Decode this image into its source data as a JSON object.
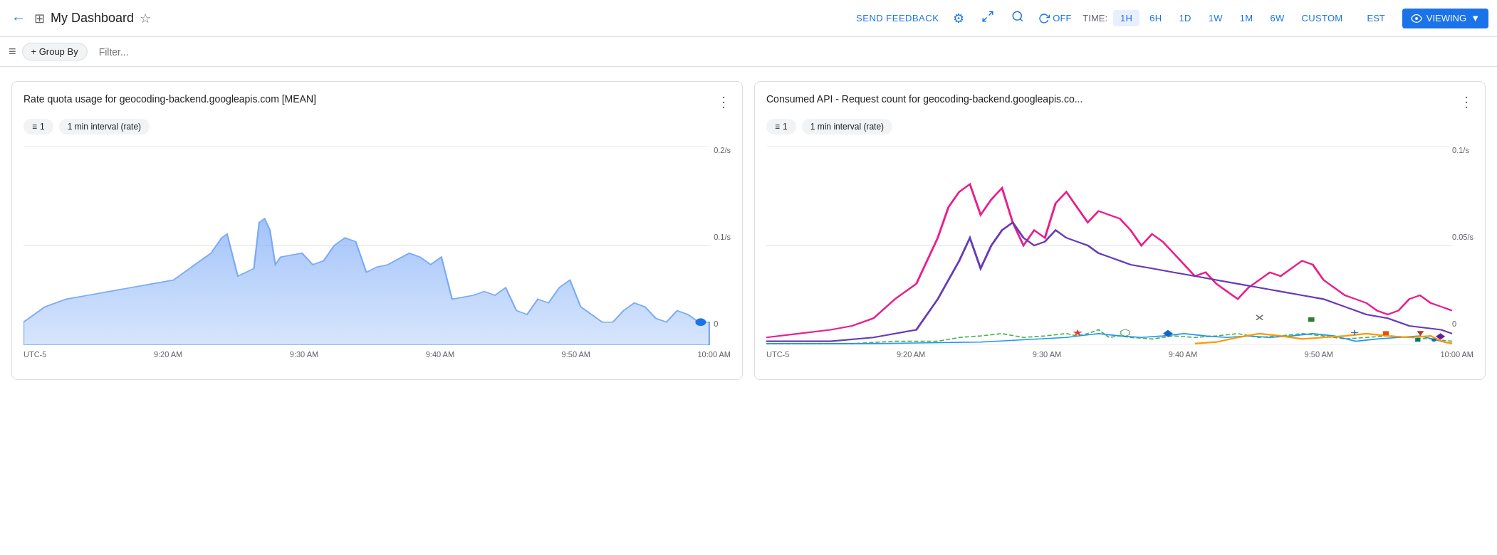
{
  "header": {
    "back_label": "←",
    "dashboard_icon": "⊞",
    "title": "My Dashboard",
    "star_icon": "☆",
    "send_feedback": "SEND FEEDBACK",
    "settings_icon": "⚙",
    "fullscreen_icon": "⛶",
    "search_icon": "🔍",
    "refresh_label": "OFF",
    "refresh_icon": "↻",
    "time_label": "TIME:",
    "time_options": [
      {
        "label": "1H",
        "active": true
      },
      {
        "label": "6H",
        "active": false
      },
      {
        "label": "1D",
        "active": false
      },
      {
        "label": "1W",
        "active": false
      },
      {
        "label": "1M",
        "active": false
      },
      {
        "label": "6W",
        "active": false
      },
      {
        "label": "CUSTOM",
        "active": false
      }
    ],
    "timezone": "EST",
    "viewing_label": "VIEWING",
    "viewing_icon": "👁"
  },
  "toolbar": {
    "hamburger_icon": "≡",
    "group_by_label": "+ Group By",
    "filter_placeholder": "Filter..."
  },
  "charts": [
    {
      "id": "chart1",
      "title": "Rate quota usage for geocoding-backend.googleapis.com [MEAN]",
      "more_icon": "⋮",
      "filter_icon": "≡",
      "filter_count": "1",
      "interval_label": "1 min interval (rate)",
      "y_axis": [
        "0.2/s",
        "0.1/s",
        "0"
      ],
      "x_axis": [
        "UTC-5",
        "9:20 AM",
        "9:30 AM",
        "9:40 AM",
        "9:50 AM",
        "10:00 AM"
      ],
      "type": "area",
      "color": "#7baaf7"
    },
    {
      "id": "chart2",
      "title": "Consumed API - Request count for geocoding-backend.googleapis.co...",
      "more_icon": "⋮",
      "filter_icon": "≡",
      "filter_count": "1",
      "interval_label": "1 min interval (rate)",
      "y_axis": [
        "0.1/s",
        "0.05/s",
        "0"
      ],
      "x_axis": [
        "UTC-5",
        "9:20 AM",
        "9:30 AM",
        "9:40 AM",
        "9:50 AM",
        "10:00 AM"
      ],
      "type": "multiline",
      "colors": [
        "#e91e8c",
        "#673ab7",
        "#4caf50",
        "#2196f3",
        "#ff9800"
      ]
    }
  ]
}
